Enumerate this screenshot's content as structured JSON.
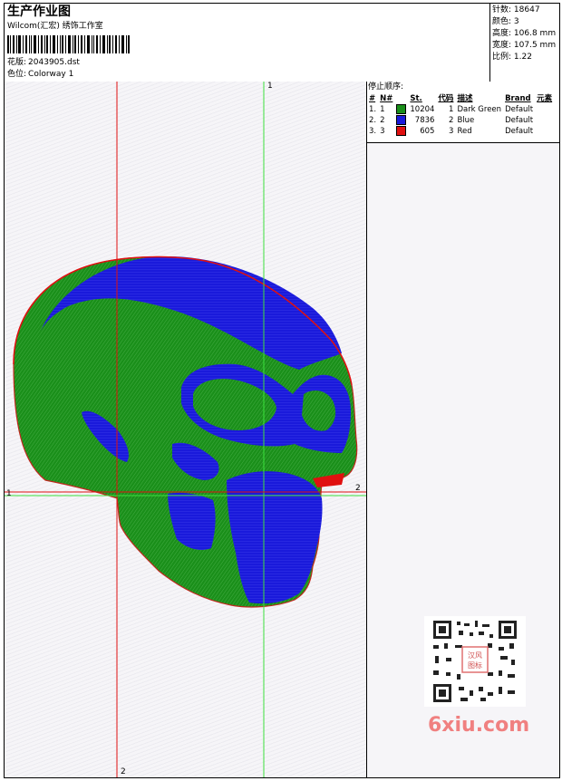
{
  "header": {
    "title": "生产作业图",
    "company": "Wilcom(汇宏) 绣饰工作室",
    "pattern_label": "花版:",
    "pattern_value": "2043905.dst",
    "colorway_label": "色位:",
    "colorway_value": "Colorway 1"
  },
  "stats": {
    "stitches_label": "针数:",
    "stitches_value": "18647",
    "colors_label": "颜色:",
    "colors_value": "3",
    "height_label": "高度:",
    "height_value": "106.8 mm",
    "width_label": "宽度:",
    "width_value": "107.5 mm",
    "scale_label": "比例:",
    "scale_value": "1.22"
  },
  "stop_sequence": {
    "title": "停止顺序:",
    "headers": [
      "#",
      "N#",
      "St.",
      "代码",
      "描述",
      "Brand",
      "元素"
    ],
    "rows": [
      {
        "idx": "1.",
        "n": "1",
        "color": "#1a8f1a",
        "st": "10204",
        "code": "1",
        "desc": "Dark Green",
        "brand": "Default"
      },
      {
        "idx": "2.",
        "n": "2",
        "color": "#1a1adb",
        "st": "7836",
        "code": "2",
        "desc": "Blue",
        "brand": "Default"
      },
      {
        "idx": "3.",
        "n": "3",
        "color": "#e01010",
        "st": "605",
        "code": "3",
        "desc": "Red",
        "brand": "Default"
      }
    ]
  },
  "axes": {
    "v_green_top": "1",
    "h_red_left": "1",
    "h_red_right": "2",
    "v_red_bottom": "2"
  },
  "colors": {
    "green": "#1a8f1a",
    "blue": "#1a1adb",
    "red": "#e01010"
  },
  "watermark": "6xiu.com",
  "qr_badge": "汉风图标"
}
